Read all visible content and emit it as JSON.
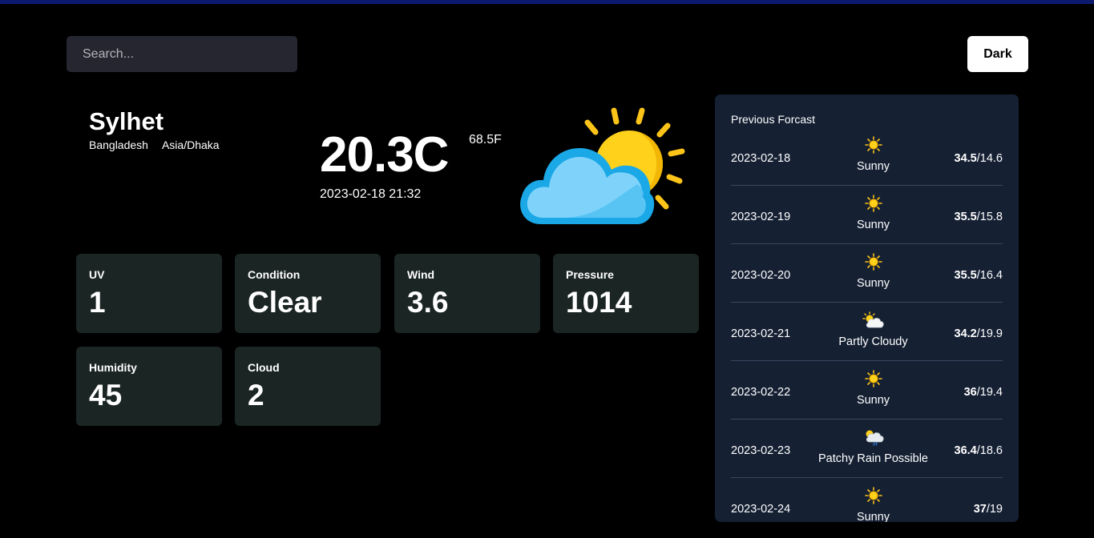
{
  "search": {
    "placeholder": "Search..."
  },
  "theme_button": {
    "label": "Dark"
  },
  "location": {
    "city": "Sylhet",
    "country": "Bangladesh",
    "timezone": "Asia/Dhaka"
  },
  "current": {
    "temp_c": "20.3C",
    "temp_f": "68.5F",
    "localtime": "2023-02-18 21:32",
    "icon": "partly-cloudy-icon"
  },
  "stats": [
    {
      "label": "UV",
      "value": "1"
    },
    {
      "label": "Condition",
      "value": "Clear"
    },
    {
      "label": "Wind",
      "value": "3.6"
    },
    {
      "label": "Pressure",
      "value": "1014"
    },
    {
      "label": "Humidity",
      "value": "45"
    },
    {
      "label": "Cloud",
      "value": "2"
    }
  ],
  "forecast": {
    "title": "Previous Forcast",
    "days": [
      {
        "date": "2023-02-18",
        "condition": "Sunny",
        "icon": "sun-icon",
        "max": "34.5",
        "min": "/14.6"
      },
      {
        "date": "2023-02-19",
        "condition": "Sunny",
        "icon": "sun-icon",
        "max": "35.5",
        "min": "/15.8"
      },
      {
        "date": "2023-02-20",
        "condition": "Sunny",
        "icon": "sun-icon",
        "max": "35.5",
        "min": "/16.4"
      },
      {
        "date": "2023-02-21",
        "condition": "Partly Cloudy",
        "icon": "partly-cloudy-icon",
        "max": "34.2",
        "min": "/19.9"
      },
      {
        "date": "2023-02-22",
        "condition": "Sunny",
        "icon": "sun-icon",
        "max": "36",
        "min": "/19.4"
      },
      {
        "date": "2023-02-23",
        "condition": "Patchy Rain Possible",
        "icon": "patchy-rain-icon",
        "max": "36.4",
        "min": "/18.6"
      },
      {
        "date": "2023-02-24",
        "condition": "Sunny",
        "icon": "sun-icon",
        "max": "37",
        "min": "/19"
      }
    ]
  },
  "colors": {
    "background": "#000000",
    "card": "#1b2524",
    "panel": "#152033",
    "accent_sun": "#fcc419",
    "cloud": "#4fc3f7"
  }
}
